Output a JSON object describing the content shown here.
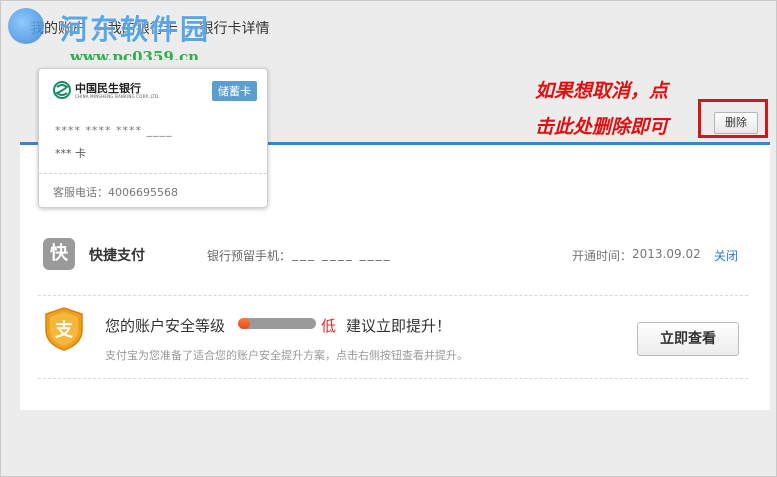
{
  "breadcrumb": {
    "items": [
      "我的账户",
      "我的银行卡",
      "银行卡详情"
    ],
    "separator": ">"
  },
  "watermark": {
    "title": "河东软件园",
    "url": "www.pc0359.cn"
  },
  "card": {
    "bank_name": "中国民生银行",
    "bank_name_en": "CHINA MINSHENG BANKING CORP.,LTD.",
    "type_badge": "储蓄卡",
    "number_masked": "**** **** **** ____",
    "holder_masked": "*** 卡",
    "service_phone": "客服电话：4006695568"
  },
  "annotation": {
    "line1": "如果想取消，点",
    "line2": "击此处删除即可",
    "color": "#e01010"
  },
  "actions": {
    "delete_label": "删除"
  },
  "quick_pay": {
    "icon_char": "快",
    "label": "快捷支付",
    "phone_label": "银行预留手机：",
    "phone_value": "___ ____ ____",
    "date_label": "开通时间：",
    "date_value": "2013.09.02",
    "close_label": "关闭"
  },
  "security": {
    "icon_char": "支",
    "label": "您的账户安全等级",
    "level_fraction": 0.15,
    "level_text": "低",
    "suggestion": "建议立即提升！",
    "description": "支付宝为您准备了适合您的账户安全提升方案，点击右侧按钮查看并提升。",
    "view_button": "立即查看"
  },
  "colors": {
    "accent_blue": "#3a85c6",
    "alert_red": "#e02a2a",
    "link_blue": "#2b7bd0"
  }
}
